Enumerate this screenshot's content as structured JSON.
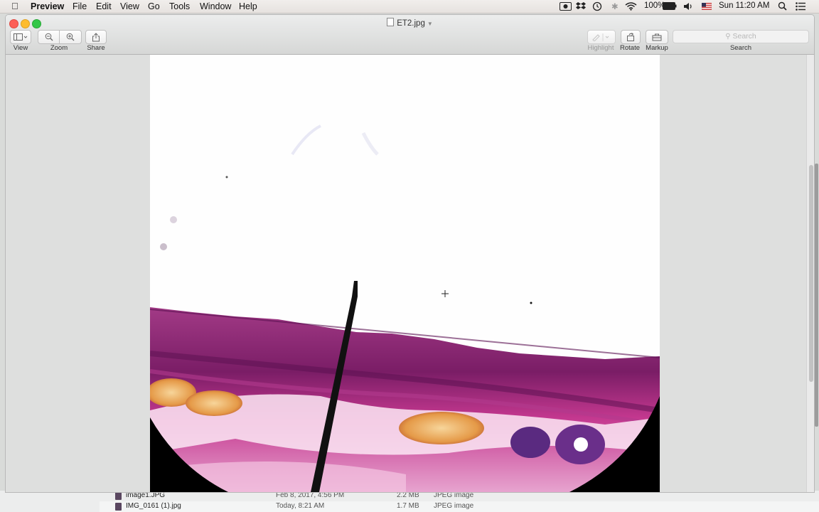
{
  "menubar": {
    "app_name": "Preview",
    "items": [
      "File",
      "Edit",
      "View",
      "Go",
      "Tools",
      "Window",
      "Help"
    ],
    "battery": "100%",
    "clock": "Sun 11:20 AM"
  },
  "window": {
    "title": "ET2.jpg",
    "toolbar": {
      "view_label": "View",
      "zoom_label": "Zoom",
      "share_label": "Share",
      "highlight_label": "Highlight",
      "rotate_label": "Rotate",
      "markup_label": "Markup",
      "search_placeholder": "Search",
      "search_label": "Search"
    }
  },
  "finder": {
    "rows": [
      {
        "name": "image1.JPG",
        "date": "Feb 8, 2017, 4:56 PM",
        "size": "2.2 MB",
        "kind": "JPEG image"
      },
      {
        "name": "IMG_0161 (1).jpg",
        "date": "Today, 8:21 AM",
        "size": "1.7 MB",
        "kind": "JPEG image"
      }
    ]
  },
  "colors": {
    "stain_purple": "#8a1f6e",
    "stain_pink": "#d24fa0",
    "fat_orange": "#e9a84f"
  }
}
